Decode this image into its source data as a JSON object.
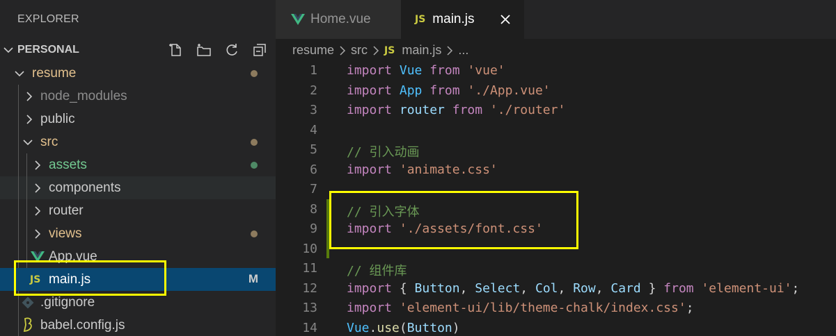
{
  "sidebar": {
    "title": "EXPLORER",
    "section": "PERSONAL",
    "actions": [
      "new-file-icon",
      "new-folder-icon",
      "refresh-icon",
      "collapse-all-icon"
    ],
    "items": [
      {
        "label": "resume",
        "type": "folder",
        "open": true
      },
      {
        "label": "node_modules",
        "type": "folder",
        "open": false
      },
      {
        "label": "public",
        "type": "folder",
        "open": false
      },
      {
        "label": "src",
        "type": "folder",
        "open": true
      },
      {
        "label": "assets",
        "type": "folder",
        "open": false
      },
      {
        "label": "components",
        "type": "folder",
        "open": false
      },
      {
        "label": "router",
        "type": "folder",
        "open": false
      },
      {
        "label": "views",
        "type": "folder",
        "open": false
      },
      {
        "label": "App.vue",
        "type": "vue"
      },
      {
        "label": "main.js",
        "type": "js",
        "badge": "M"
      },
      {
        "label": ".gitignore",
        "type": "git"
      },
      {
        "label": "babel.config.js",
        "type": "babel"
      }
    ]
  },
  "tabs": [
    {
      "label": "Home.vue",
      "active": false
    },
    {
      "label": "main.js",
      "active": true
    }
  ],
  "tab_icons": {
    "js": "JS"
  },
  "breadcrumb": [
    "resume",
    "src",
    "main.js",
    "..."
  ],
  "code": {
    "line_numbers": [
      "1",
      "2",
      "3",
      "4",
      "5",
      "6",
      "7",
      "8",
      "9",
      "10",
      "11",
      "12",
      "13",
      "14"
    ],
    "lines": [
      [
        [
          "kw",
          "import"
        ],
        [
          "plain",
          " "
        ],
        [
          "id",
          "Vue"
        ],
        [
          "plain",
          " "
        ],
        [
          "kw",
          "from"
        ],
        [
          "plain",
          " "
        ],
        [
          "str",
          "'vue'"
        ]
      ],
      [
        [
          "kw",
          "import"
        ],
        [
          "plain",
          " "
        ],
        [
          "id",
          "App"
        ],
        [
          "plain",
          " "
        ],
        [
          "kw",
          "from"
        ],
        [
          "plain",
          " "
        ],
        [
          "str",
          "'./App.vue'"
        ]
      ],
      [
        [
          "kw",
          "import"
        ],
        [
          "plain",
          " "
        ],
        [
          "var",
          "router"
        ],
        [
          "plain",
          " "
        ],
        [
          "kw",
          "from"
        ],
        [
          "plain",
          " "
        ],
        [
          "str",
          "'./router'"
        ]
      ],
      [],
      [
        [
          "cmt",
          "// 引入动画"
        ]
      ],
      [
        [
          "kw",
          "import"
        ],
        [
          "plain",
          " "
        ],
        [
          "str",
          "'animate.css'"
        ]
      ],
      [],
      [
        [
          "cmt",
          "// 引入字体"
        ]
      ],
      [
        [
          "kw",
          "import"
        ],
        [
          "plain",
          " "
        ],
        [
          "str",
          "'./assets/font.css'"
        ]
      ],
      [],
      [
        [
          "cmt",
          "// 组件库"
        ]
      ],
      [
        [
          "kw",
          "import"
        ],
        [
          "plain",
          " { "
        ],
        [
          "var",
          "Button"
        ],
        [
          "plain",
          ", "
        ],
        [
          "var",
          "Select"
        ],
        [
          "plain",
          ", "
        ],
        [
          "var",
          "Col"
        ],
        [
          "plain",
          ", "
        ],
        [
          "var",
          "Row"
        ],
        [
          "plain",
          ", "
        ],
        [
          "var",
          "Card"
        ],
        [
          "plain",
          " } "
        ],
        [
          "kw",
          "from"
        ],
        [
          "plain",
          " "
        ],
        [
          "str",
          "'element-ui'"
        ],
        [
          "plain",
          ";"
        ]
      ],
      [
        [
          "kw",
          "import"
        ],
        [
          "plain",
          " "
        ],
        [
          "str",
          "'element-ui/lib/theme-chalk/index.css'"
        ],
        [
          "plain",
          ";"
        ]
      ],
      [
        [
          "id",
          "Vue"
        ],
        [
          "plain",
          "."
        ],
        [
          "fn",
          "use"
        ],
        [
          "plain",
          "("
        ],
        [
          "var",
          "Button"
        ],
        [
          "plain",
          ")"
        ]
      ]
    ]
  },
  "colors": {
    "modified": "#e2c08d",
    "untracked": "#73c991",
    "highlight": "#ffff00",
    "selected": "#094771"
  }
}
